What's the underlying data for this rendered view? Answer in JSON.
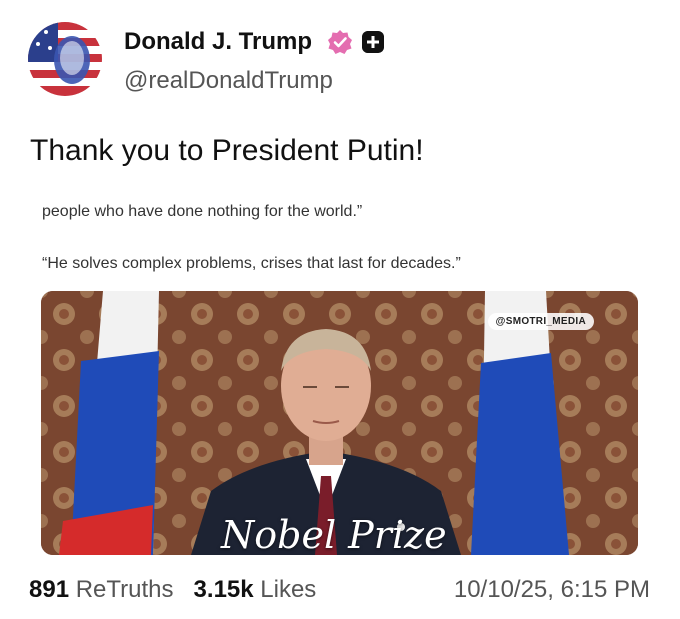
{
  "author": {
    "display_name": "Donald J. Trump",
    "handle": "@realDonaldTrump",
    "verified_icon": "verified-badge-icon",
    "membership_icon": "plus-badge-icon",
    "verified_color": "#e46db0"
  },
  "post": {
    "text": "Thank you to President Putin!",
    "quoted_lines": [
      "people who have done nothing for the world.”",
      "“He solves complex problems, crises that last for decades.”"
    ]
  },
  "media": {
    "watermark": "@SMOTRI_MEDIA",
    "caption": "Nobel Prize"
  },
  "stats": {
    "retruths_count": "891",
    "retruths_label": "ReTruths",
    "likes_count": "3.15k",
    "likes_label": "Likes",
    "timestamp": "10/10/25, 6:15 PM"
  }
}
